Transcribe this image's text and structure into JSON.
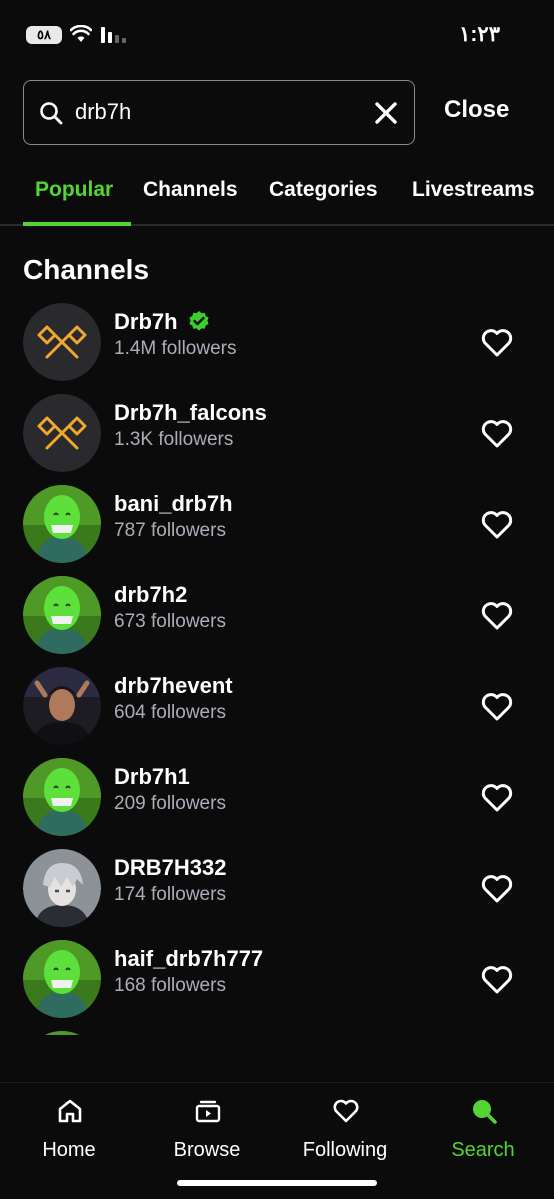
{
  "status": {
    "battery": "٥٨",
    "time": "١:٢٣"
  },
  "search": {
    "value": "drb7h",
    "placeholder": "Search",
    "close_label": "Close"
  },
  "tabs": [
    {
      "label": "Popular",
      "active": true
    },
    {
      "label": "Channels",
      "active": false
    },
    {
      "label": "Categories",
      "active": false
    },
    {
      "label": "Livestreams",
      "active": false
    }
  ],
  "section_title": "Channels",
  "channels": [
    {
      "name": "Drb7h",
      "followers": "1.4M followers",
      "verified": true,
      "avatar": "logo"
    },
    {
      "name": "Drb7h_falcons",
      "followers": "1.3K followers",
      "verified": false,
      "avatar": "logo"
    },
    {
      "name": "bani_drb7h",
      "followers": "787 followers",
      "verified": false,
      "avatar": "green-character"
    },
    {
      "name": "drb7h2",
      "followers": "673 followers",
      "verified": false,
      "avatar": "green-character"
    },
    {
      "name": "drb7hevent",
      "followers": "604 followers",
      "verified": false,
      "avatar": "person-photo"
    },
    {
      "name": "Drb7h1",
      "followers": "209 followers",
      "verified": false,
      "avatar": "green-character"
    },
    {
      "name": "DRB7H332",
      "followers": "174 followers",
      "verified": false,
      "avatar": "anime-character"
    },
    {
      "name": "haif_drb7h777",
      "followers": "168 followers",
      "verified": false,
      "avatar": "green-character"
    }
  ],
  "nav": [
    {
      "label": "Home",
      "icon": "home-icon",
      "active": false
    },
    {
      "label": "Browse",
      "icon": "browse-icon",
      "active": false
    },
    {
      "label": "Following",
      "icon": "heart-icon",
      "active": false
    },
    {
      "label": "Search",
      "icon": "search-icon",
      "active": true
    }
  ],
  "colors": {
    "accent": "#53d534",
    "background": "#0b0b0c",
    "muted_text": "#adadb8"
  }
}
